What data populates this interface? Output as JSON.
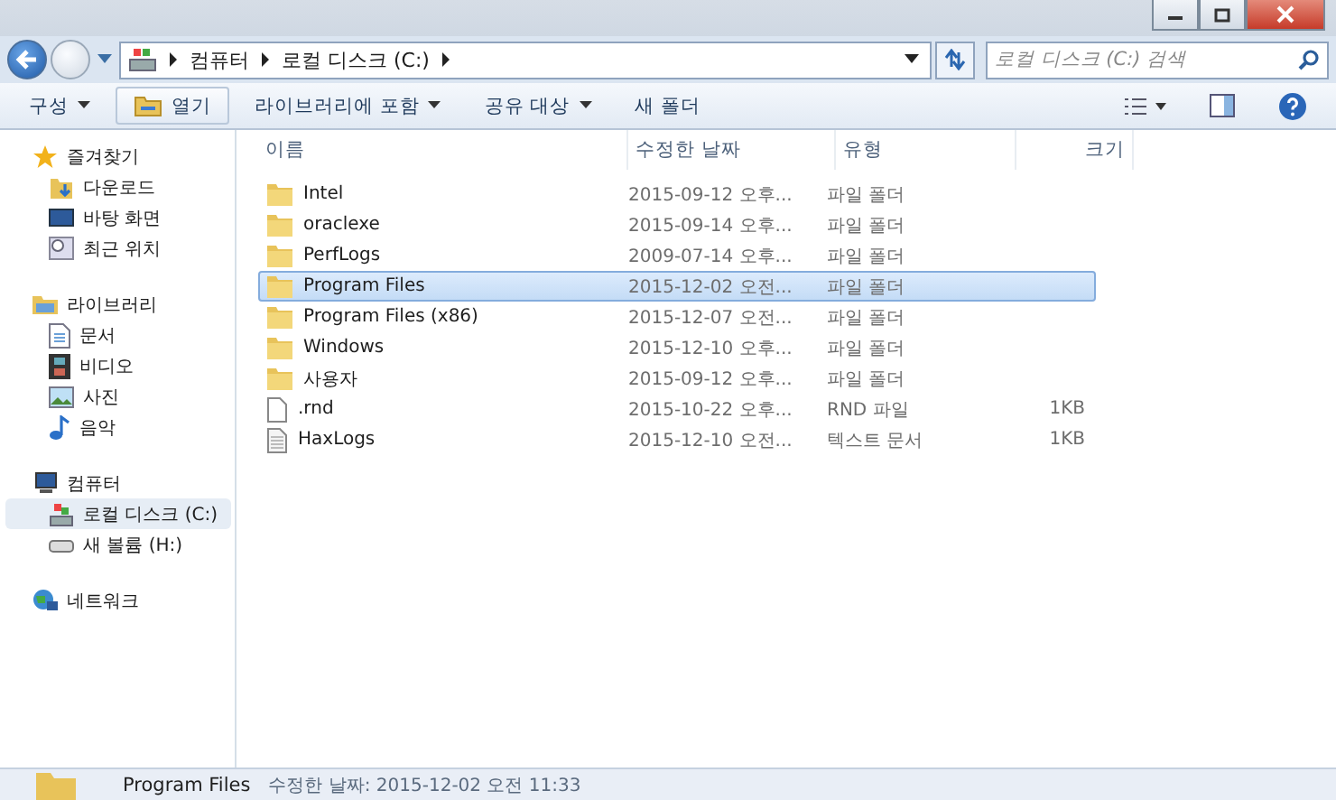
{
  "address_bar": {
    "crumbs": [
      "컴퓨터",
      "로컬 디스크 (C:)"
    ],
    "search": {
      "placeholder": "로컬 디스크 (C:) 검색"
    }
  },
  "toolbar": {
    "buttons": [
      {
        "label": "구성",
        "dropdown": true,
        "kind": "text"
      },
      {
        "label": "열기",
        "dropdown": false,
        "kind": "icon"
      },
      {
        "label": "라이브러리에 포함",
        "dropdown": true,
        "kind": "text"
      },
      {
        "label": "공유 대상",
        "dropdown": true,
        "kind": "text"
      },
      {
        "label": "새 폴더",
        "dropdown": false,
        "kind": "text"
      }
    ]
  },
  "sidebar": {
    "groups": [
      {
        "label": "즐겨찾기",
        "items": [
          {
            "label": "다운로드",
            "selected": false
          },
          {
            "label": "바탕 화면",
            "selected": false
          },
          {
            "label": "최근 위치",
            "selected": false
          }
        ]
      },
      {
        "label": "라이브러리",
        "items": [
          {
            "label": "문서",
            "selected": false
          },
          {
            "label": "비디오",
            "selected": false
          },
          {
            "label": "사진",
            "selected": false
          },
          {
            "label": "음악",
            "selected": false
          }
        ]
      },
      {
        "label": "컴퓨터",
        "items": [
          {
            "label": "로컬 디스크 (C:)",
            "selected": true
          },
          {
            "label": "새 볼륨 (H:)",
            "selected": false
          }
        ]
      },
      {
        "label": "네트워크"
      }
    ]
  },
  "table": {
    "columns": [
      "이름",
      "수정한 날짜",
      "유형",
      "크기"
    ],
    "rows": [
      {
        "name": "Intel",
        "date": "2015-09-12 오후...",
        "type": "파일 폴더",
        "size": "",
        "kind": "folder",
        "selected": false
      },
      {
        "name": "oraclexe",
        "date": "2015-09-14 오후...",
        "type": "파일 폴더",
        "size": "",
        "kind": "folder",
        "selected": false
      },
      {
        "name": "PerfLogs",
        "date": "2009-07-14 오후...",
        "type": "파일 폴더",
        "size": "",
        "kind": "folder",
        "selected": false
      },
      {
        "name": "Program Files",
        "date": "2015-12-02 오전...",
        "type": "파일 폴더",
        "size": "",
        "kind": "folder",
        "selected": true
      },
      {
        "name": "Program Files (x86)",
        "date": "2015-12-07 오전...",
        "type": "파일 폴더",
        "size": "",
        "kind": "folder",
        "selected": false
      },
      {
        "name": "Windows",
        "date": "2015-12-10 오후...",
        "type": "파일 폴더",
        "size": "",
        "kind": "folder",
        "selected": false
      },
      {
        "name": "사용자",
        "date": "2015-09-12 오후...",
        "type": "파일 폴더",
        "size": "",
        "kind": "folder",
        "selected": false
      },
      {
        "name": ".rnd",
        "date": "2015-10-22 오후...",
        "type": "RND 파일",
        "size": "1KB",
        "kind": "file",
        "selected": false
      },
      {
        "name": "HaxLogs",
        "date": "2015-12-10 오전...",
        "type": "텍스트 문서",
        "size": "1KB",
        "kind": "text",
        "selected": false
      }
    ]
  },
  "details_pane": {
    "name": "Program Files",
    "modified": "수정한 날짜: 2015-12-02 오전 11:33"
  }
}
